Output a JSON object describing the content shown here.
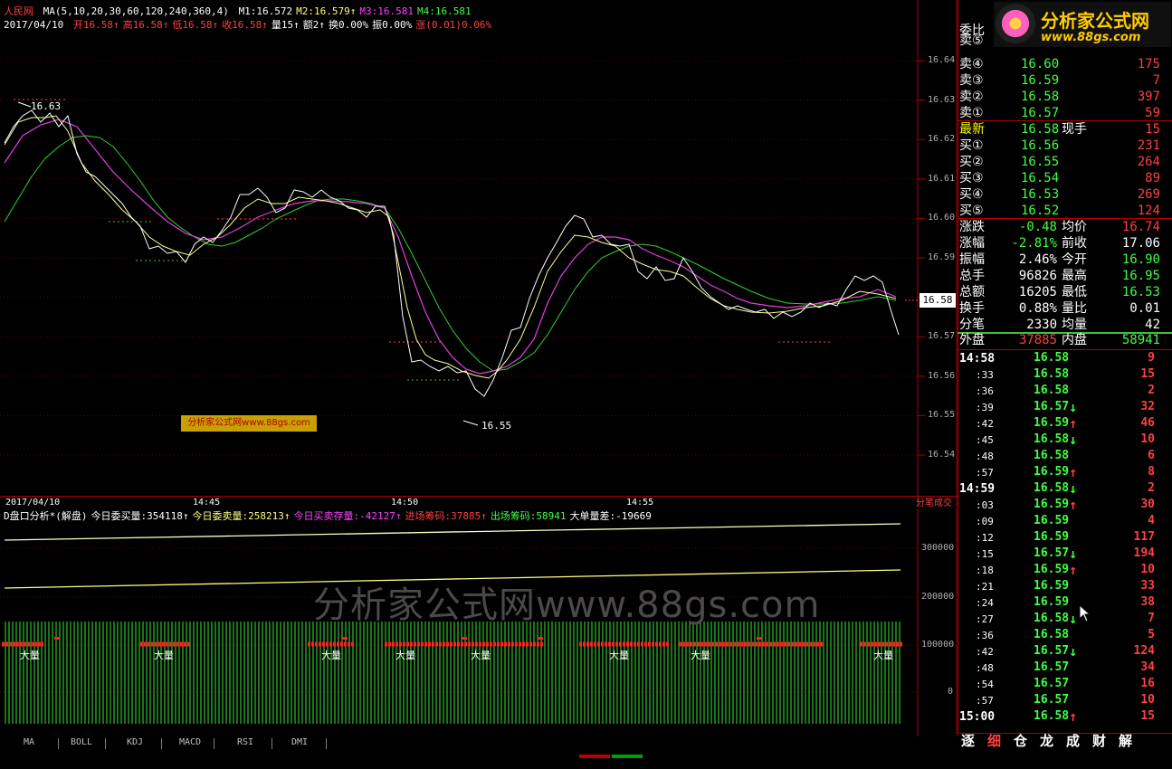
{
  "header": {
    "title": "人民网",
    "ma_prefix": "MA(5,10,20,30,60,120,240,360,4)",
    "ma": [
      {
        "label": "M1:16.572",
        "color": "#ffffff"
      },
      {
        "label": "M2:16.579↑",
        "color": "#ffff80"
      },
      {
        "label": "M3:16.581",
        "color": "#ff40ff"
      },
      {
        "label": "M4:16.581",
        "color": "#40ff40"
      }
    ],
    "date": "2017/04/10",
    "quote_line": [
      {
        "label": "开16.58↑",
        "color": "#ff4040"
      },
      {
        "label": "高16.58↑",
        "color": "#ff4040"
      },
      {
        "label": "低16.58↑",
        "color": "#ff4040"
      },
      {
        "label": "收16.58↑",
        "color": "#ff4040"
      },
      {
        "label": "量15↑",
        "color": "#ffffff"
      },
      {
        "label": "额2↑",
        "color": "#ffffff"
      },
      {
        "label": "换0.00%",
        "color": "#ffffff"
      },
      {
        "label": "振0.00%",
        "color": "#ffffff"
      },
      {
        "label": "涨(0.01)0.06%",
        "color": "#ff4040"
      }
    ]
  },
  "price_axis": [
    "16.64",
    "16.63",
    "16.62",
    "16.61",
    "16.60",
    "16.59",
    "16.58",
    "16.57",
    "16.56",
    "16.55",
    "16.54"
  ],
  "current_price_tag": "16.58",
  "chart_annotations": {
    "high": "16.63",
    "low": "16.55"
  },
  "watermark_small": "分析家公式网www.88gs.com",
  "watermark_big": "分析家公式网www.88gs.com",
  "time_axis": {
    "date": "2017/04/10",
    "ticks": [
      "14:45",
      "14:50",
      "14:55"
    ],
    "right_label": "分笔成交"
  },
  "indicator": {
    "items": [
      {
        "label": "D盘口分析*(解盘)",
        "color": "#ffffff"
      },
      {
        "label": "今日委买量:354118↑",
        "color": "#ffffff"
      },
      {
        "label": "今日委卖量:258213↑",
        "color": "#ffff80"
      },
      {
        "label": "今日买卖存量:-42127↑",
        "color": "#ff40ff"
      },
      {
        "label": "进场筹码:37885↑",
        "color": "#ff4040"
      },
      {
        "label": "出场筹码:58941",
        "color": "#40ff40"
      },
      {
        "label": "大单量差:-19669",
        "color": "#ffffff"
      }
    ],
    "axis": [
      "300000",
      "200000",
      "100000",
      "0"
    ],
    "big_label": "大量"
  },
  "tabs": [
    "MA",
    "BOLL",
    "KDJ",
    "MACD",
    "RSI",
    "DMI"
  ],
  "logo": {
    "title": "分析家公式网",
    "url": "www.88gs.com"
  },
  "order_book": {
    "header": "委比",
    "asks": [
      {
        "label": "卖⑤",
        "price": "",
        "vol": ""
      },
      {
        "label": "卖④",
        "price": "16.60",
        "vol": "175"
      },
      {
        "label": "卖③",
        "price": "16.59",
        "vol": "7"
      },
      {
        "label": "卖②",
        "price": "16.58",
        "vol": "397"
      },
      {
        "label": "卖①",
        "price": "16.57",
        "vol": "59"
      }
    ],
    "last": {
      "label": "最新",
      "price": "16.58",
      "extra": "现手",
      "vol": "15"
    },
    "bids": [
      {
        "label": "买①",
        "price": "16.56",
        "vol": "231"
      },
      {
        "label": "买②",
        "price": "16.55",
        "vol": "264"
      },
      {
        "label": "买③",
        "price": "16.54",
        "vol": "89"
      },
      {
        "label": "买④",
        "price": "16.53",
        "vol": "269"
      },
      {
        "label": "买⑤",
        "price": "16.52",
        "vol": "124"
      }
    ]
  },
  "stats": [
    {
      "l1": "涨跌",
      "v1": "-0.48",
      "c1": "#40ff40",
      "l2": "均价",
      "v2": "16.74",
      "c2": "#ff4040"
    },
    {
      "l1": "涨幅",
      "v1": "-2.81%",
      "c1": "#40ff40",
      "l2": "前收",
      "v2": "17.06",
      "c2": "#ffffff"
    },
    {
      "l1": "振幅",
      "v1": "2.46%",
      "c1": "#ffffff",
      "l2": "今开",
      "v2": "16.90",
      "c2": "#40ff40"
    },
    {
      "l1": "总手",
      "v1": "96826",
      "c1": "#ffffff",
      "l2": "最高",
      "v2": "16.95",
      "c2": "#40ff40"
    },
    {
      "l1": "总额",
      "v1": "16205",
      "c1": "#ffffff",
      "l2": "最低",
      "v2": "16.53",
      "c2": "#40ff40"
    },
    {
      "l1": "换手",
      "v1": "0.88%",
      "c1": "#ffffff",
      "l2": "量比",
      "v2": "0.01",
      "c2": "#ffffff"
    },
    {
      "l1": "分笔",
      "v1": "2330",
      "c1": "#ffffff",
      "l2": "均量",
      "v2": "42",
      "c2": "#ffffff"
    }
  ],
  "outer_inner": {
    "l1": "外盘",
    "v1": "37885",
    "l2": "内盘",
    "v2": "58941"
  },
  "ticks": [
    {
      "t": "14:58",
      "p": "16.58",
      "d": "",
      "v": "9"
    },
    {
      "t": ":33",
      "p": "16.58",
      "d": "",
      "v": "15"
    },
    {
      "t": ":36",
      "p": "16.58",
      "d": "",
      "v": "2"
    },
    {
      "t": ":39",
      "p": "16.57",
      "d": "down",
      "v": "32"
    },
    {
      "t": ":42",
      "p": "16.59",
      "d": "up",
      "v": "46"
    },
    {
      "t": ":45",
      "p": "16.58",
      "d": "down",
      "v": "10"
    },
    {
      "t": ":48",
      "p": "16.58",
      "d": "",
      "v": "6"
    },
    {
      "t": ":57",
      "p": "16.59",
      "d": "up",
      "v": "8"
    },
    {
      "t": "14:59",
      "p": "16.58",
      "d": "down",
      "v": "2"
    },
    {
      "t": ":03",
      "p": "16.59",
      "d": "up",
      "v": "30"
    },
    {
      "t": ":09",
      "p": "16.59",
      "d": "",
      "v": "4"
    },
    {
      "t": ":12",
      "p": "16.59",
      "d": "",
      "v": "117"
    },
    {
      "t": ":15",
      "p": "16.57",
      "d": "down",
      "v": "194"
    },
    {
      "t": ":18",
      "p": "16.59",
      "d": "up",
      "v": "10"
    },
    {
      "t": ":21",
      "p": "16.59",
      "d": "",
      "v": "33"
    },
    {
      "t": ":24",
      "p": "16.59",
      "d": "",
      "v": "38"
    },
    {
      "t": ":27",
      "p": "16.58",
      "d": "down",
      "v": "7"
    },
    {
      "t": ":36",
      "p": "16.58",
      "d": "",
      "v": "5"
    },
    {
      "t": ":42",
      "p": "16.57",
      "d": "down",
      "v": "124"
    },
    {
      "t": ":48",
      "p": "16.57",
      "d": "",
      "v": "34"
    },
    {
      "t": ":54",
      "p": "16.57",
      "d": "",
      "v": "16"
    },
    {
      "t": ":57",
      "p": "16.57",
      "d": "",
      "v": "10"
    },
    {
      "t": "15:00",
      "p": "16.58",
      "d": "up",
      "v": "15"
    }
  ],
  "side_tabs": [
    "逐",
    "细",
    "仓",
    "龙",
    "成",
    "财",
    "解"
  ]
}
